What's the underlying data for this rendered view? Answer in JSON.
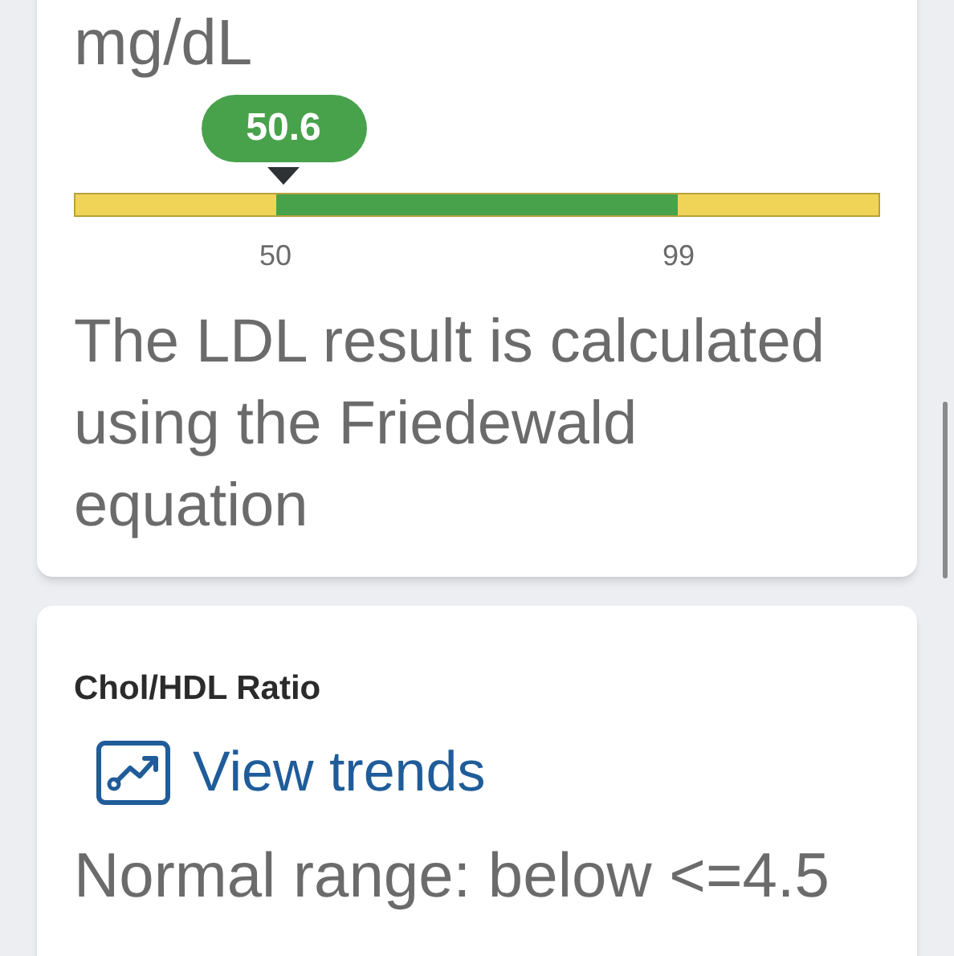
{
  "ldl_card": {
    "unit": "mg/dL",
    "range_bar": {
      "value_label": "50.6",
      "segments": [
        {
          "color": "#f0d458",
          "level": 0.25
        },
        {
          "color": "#48a24c",
          "level": 0.5
        },
        {
          "color": "#f0d458",
          "level": 0.25
        }
      ],
      "ticks": [
        "50",
        "99"
      ]
    },
    "note": "The LDL result is calculated using the Friedewald equation"
  },
  "ratio_card": {
    "title": "Chol/HDL Ratio",
    "trends_link": "View trends",
    "normal_range": "Normal range: below <=4.5"
  }
}
